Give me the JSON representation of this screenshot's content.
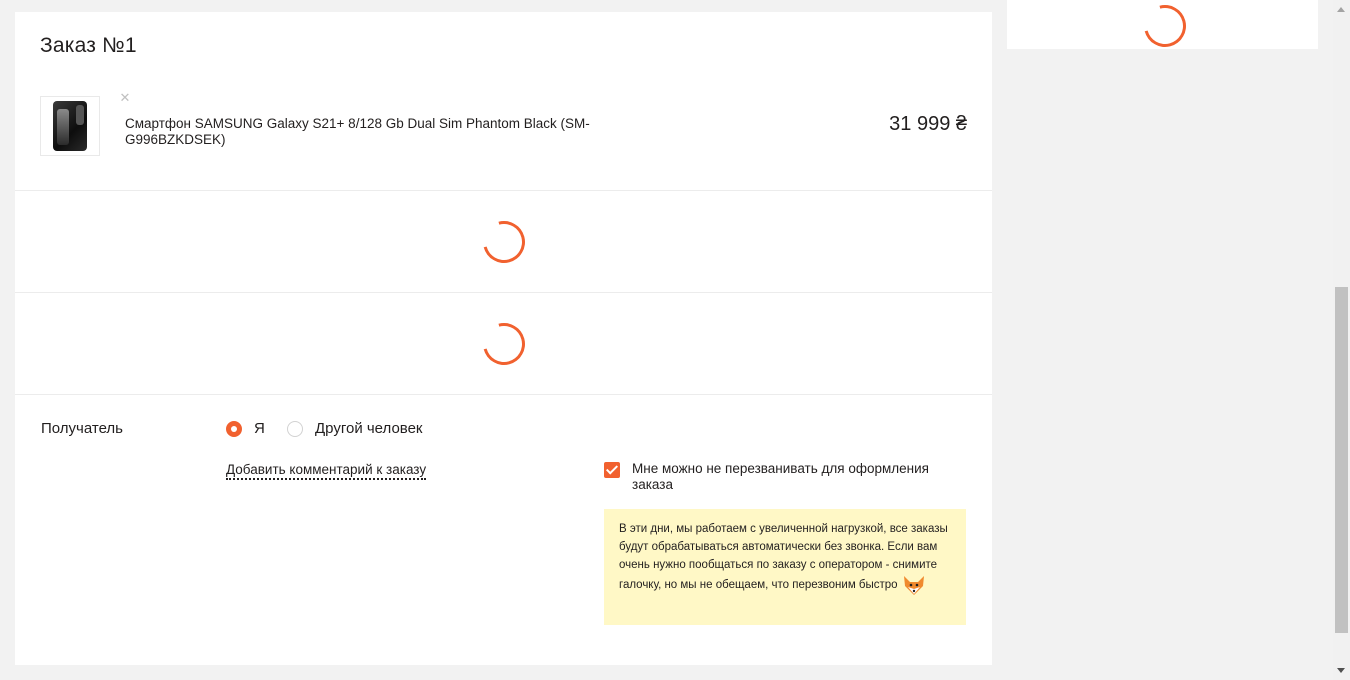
{
  "order": {
    "title": "Заказ №1",
    "product": {
      "name": "Смартфон SAMSUNG Galaxy S21+ 8/128 Gb Dual Sim Phantom Black (SM-G996BZKDSEK)",
      "price": "31 999 ₴",
      "remove_icon": "close-icon"
    }
  },
  "recipient": {
    "label": "Получатель",
    "options": [
      {
        "label": "Я",
        "selected": true
      },
      {
        "label": "Другой человек",
        "selected": false
      }
    ],
    "comment_link": "Добавить комментарий к заказу"
  },
  "callback": {
    "checkbox_label": "Мне можно не перезванивать для оформления заказа",
    "checked": true,
    "notice": "В эти дни, мы работаем с увеличенной нагрузкой, все заказы будут обрабатываться автоматически без звонка. Если вам очень нужно пообщаться по заказу с оператором - снимите галочку, но мы не обещаем, что перезвоним быстро"
  },
  "colors": {
    "accent": "#f1612f",
    "notice_bg": "#fff8c6",
    "page_bg": "#f2f2f2"
  }
}
